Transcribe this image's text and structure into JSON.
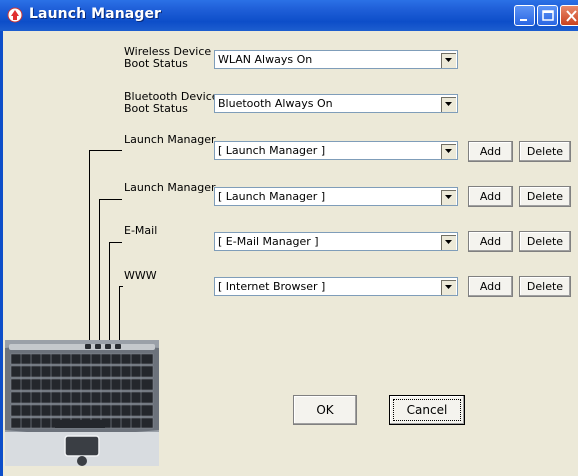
{
  "window": {
    "title": "Launch Manager"
  },
  "rows": [
    {
      "label": "Wireless Device\nBoot Status",
      "value": "WLAN Always On"
    },
    {
      "label": "Bluetooth Device\nBoot Status",
      "value": "Bluetooth Always On"
    },
    {
      "label": "Launch Manager",
      "value": "[  Launch Manager  ]",
      "add": "Add",
      "delete": "Delete"
    },
    {
      "label": "Launch Manager",
      "value": "[  Launch Manager  ]",
      "add": "Add",
      "delete": "Delete"
    },
    {
      "label": "E-Mail",
      "value": "[  E-Mail Manager  ]",
      "add": "Add",
      "delete": "Delete"
    },
    {
      "label": "WWW",
      "value": "[  Internet Browser  ]",
      "add": "Add",
      "delete": "Delete"
    }
  ],
  "buttons": {
    "ok": "OK",
    "cancel": "Cancel"
  },
  "colors": {
    "titlebar": "#0d4ec9",
    "face": "#ece9d8",
    "combo_border": "#7f9db9"
  }
}
